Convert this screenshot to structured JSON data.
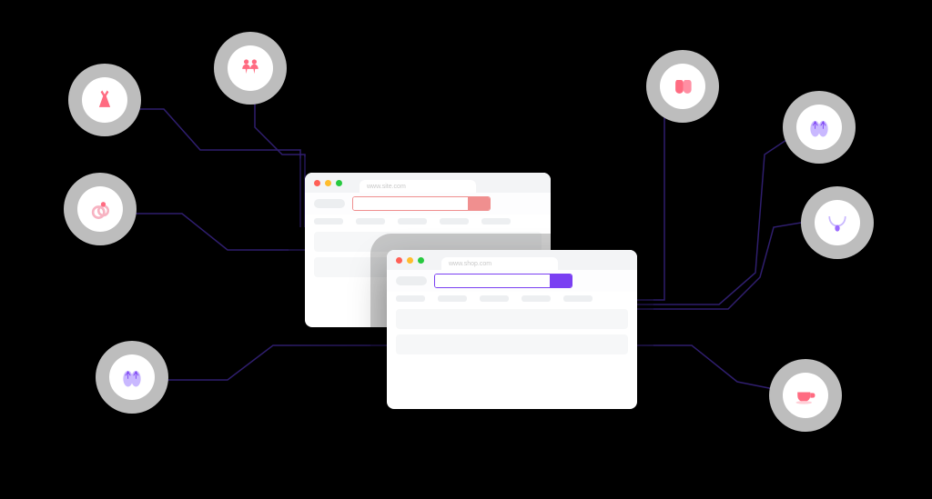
{
  "categories": {
    "dress": {
      "name": "dress"
    },
    "earrings": {
      "name": "earrings"
    },
    "ring": {
      "name": "ring"
    },
    "sandals": {
      "name": "sandals"
    },
    "slippers": {
      "name": "slippers"
    },
    "flipflops": {
      "name": "flip-flops"
    },
    "necklace": {
      "name": "necklace"
    },
    "coffee": {
      "name": "coffee-cup"
    }
  },
  "browser_red": {
    "url": "www.site.com",
    "traffic_lights": [
      "#ff5f56",
      "#ffbd2e",
      "#27c93f"
    ],
    "accent": "#f08f8f"
  },
  "browser_purple": {
    "url": "www.shop.com",
    "traffic_lights": [
      "#ff5f56",
      "#ffbd2e",
      "#27c93f"
    ],
    "accent": "#7a3ff2"
  },
  "connector_color": "#2f1e6e"
}
